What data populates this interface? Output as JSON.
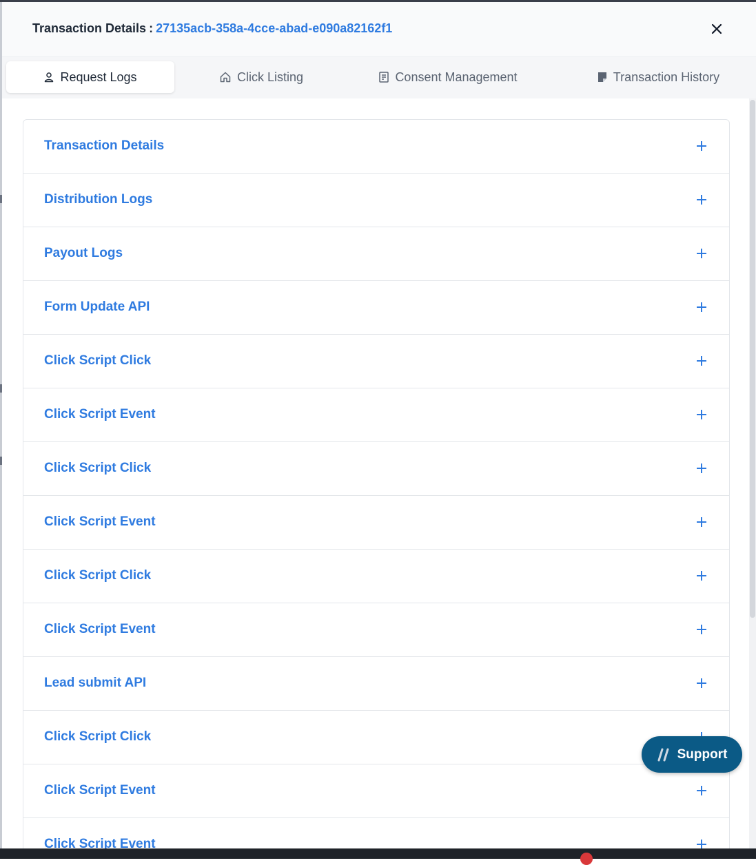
{
  "header": {
    "title_label": "Transaction Details",
    "title_separator": ":",
    "transaction_id": "27135acb-358a-4cce-abad-e090a82162f1",
    "close_icon": "close-icon"
  },
  "tabs": [
    {
      "label": "Request Logs",
      "icon": "user-icon",
      "active": true
    },
    {
      "label": "Click Listing",
      "icon": "home-icon",
      "active": false
    },
    {
      "label": "Consent Management",
      "icon": "receipt-icon",
      "active": false
    },
    {
      "label": "Transaction History",
      "icon": "note-icon",
      "active": false
    }
  ],
  "accordion": {
    "items": [
      {
        "label": "Transaction Details"
      },
      {
        "label": "Distribution Logs"
      },
      {
        "label": "Payout Logs"
      },
      {
        "label": "Form Update API"
      },
      {
        "label": "Click Script Click"
      },
      {
        "label": "Click Script Event"
      },
      {
        "label": "Click Script Click"
      },
      {
        "label": "Click Script Event"
      },
      {
        "label": "Click Script Click"
      },
      {
        "label": "Click Script Event"
      },
      {
        "label": "Lead submit API"
      },
      {
        "label": "Click Script Click"
      },
      {
        "label": "Click Script Event"
      },
      {
        "label": "Click Script Event"
      }
    ],
    "expand_icon": "plus-icon"
  },
  "support": {
    "label": "Support",
    "icon": "support-slash-icon"
  },
  "colors": {
    "accent": "#2f7be0",
    "support_bg": "#0b5a86",
    "title_text": "#1f2937"
  }
}
